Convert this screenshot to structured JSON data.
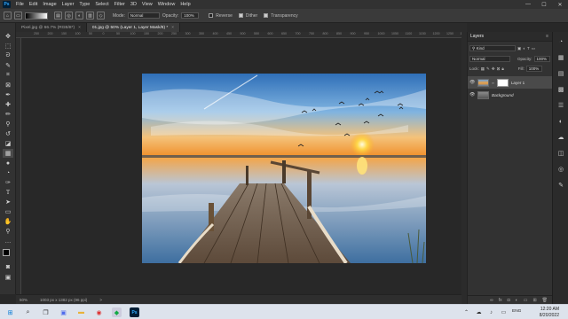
{
  "menubar": {
    "logo": "Ps",
    "items": [
      "File",
      "Edit",
      "Image",
      "Layer",
      "Type",
      "Select",
      "Filter",
      "3D",
      "View",
      "Window",
      "Help"
    ],
    "minimize": "—",
    "maximize": "☐",
    "close": "✕"
  },
  "options": {
    "mode_label": "Mode:",
    "mode_value": "Normal",
    "opacity_label": "Opacity:",
    "opacity_value": "100%",
    "reverse_label": "Reverse",
    "dither_label": "Dither",
    "transparency_label": "Transparency"
  },
  "tabs": [
    {
      "label": "Pixel.jpg @ 66.7% (RGB/8*)",
      "close": "×"
    },
    {
      "label": "01.jpg @ 50% (Layer 1, Layer Mask/8) *",
      "close": "×"
    }
  ],
  "ruler_ticks": [
    "250",
    "200",
    "150",
    "100",
    "50",
    "0",
    "50",
    "100",
    "150",
    "200",
    "250",
    "300",
    "350",
    "400",
    "450",
    "500",
    "550",
    "600",
    "650",
    "700",
    "750",
    "800",
    "850",
    "900",
    "950",
    "1000",
    "1050",
    "1100",
    "1150",
    "1200",
    "1250",
    "1300"
  ],
  "status": {
    "zoom": "50%",
    "doc_size": "1003 px x 1382 px (96 ppi)",
    "arrow": ">"
  },
  "layers_panel": {
    "title": "Layers",
    "kind_label": "Kind",
    "blend_mode": "Normal",
    "opacity_label": "Opacity:",
    "opacity_value": "100%",
    "lock_label": "Lock:",
    "fill_label": "Fill:",
    "fill_value": "100%",
    "layers": [
      {
        "name": "Layer 1",
        "active": true
      },
      {
        "name": "Background",
        "active": false
      }
    ],
    "footer_icons": [
      "link-icon",
      "fx-icon",
      "mask-icon",
      "adjustment-icon",
      "folder-icon",
      "new-layer-icon",
      "trash-icon"
    ],
    "footer_fx": "fx"
  },
  "taskbar": {
    "search_glyph": "⌕",
    "language": "ENG",
    "time": "12:20 AM",
    "date": "8/20/2022"
  },
  "colors": {
    "accent": "#31a8ff",
    "app_bg": "#282828",
    "panel_bg": "#323232",
    "taskbar_bg": "#dde3ec"
  }
}
